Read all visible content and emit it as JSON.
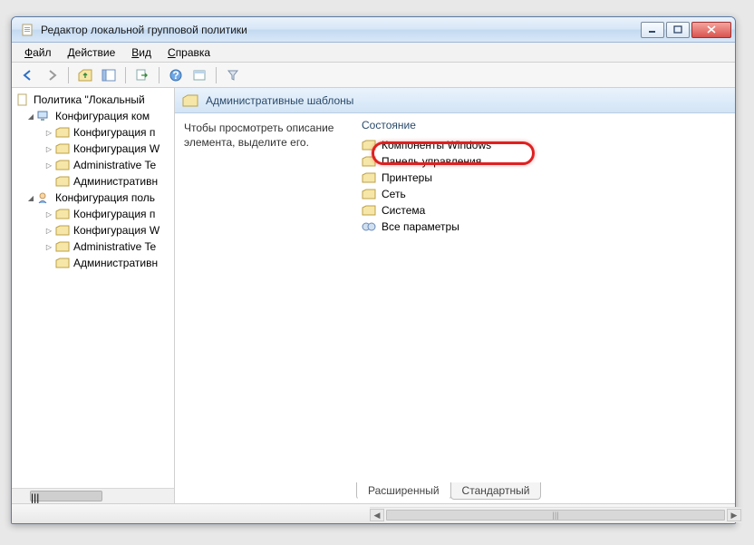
{
  "window": {
    "title": "Редактор локальной групповой политики"
  },
  "menubar": {
    "file": "Файл",
    "action": "Действие",
    "view": "Вид",
    "help": "Справка"
  },
  "toolbar": {
    "back": "back",
    "forward": "forward"
  },
  "tree": {
    "root": "Политика \"Локальный",
    "n1": "Конфигурация ком",
    "n1a": "Конфигурация п",
    "n1b": "Конфигурация W",
    "n1c": "Administrative Te",
    "n1d": "Административн",
    "n2": "Конфигурация поль",
    "n2a": "Конфигурация п",
    "n2b": "Конфигурация W",
    "n2c": "Administrative Te",
    "n2d": "Административн"
  },
  "header": {
    "title": "Административные шаблоны"
  },
  "description": "Чтобы просмотреть описание элемента, выделите его.",
  "list": {
    "column": "Состояние",
    "i0": "Компоненты Windows",
    "i1": "Панель управления",
    "i2": "Принтеры",
    "i3": "Сеть",
    "i4": "Система",
    "i5": "Все параметры"
  },
  "tabs": {
    "t0": "Расширенный",
    "t1": "Стандартный"
  },
  "scroll_grip": "|||"
}
